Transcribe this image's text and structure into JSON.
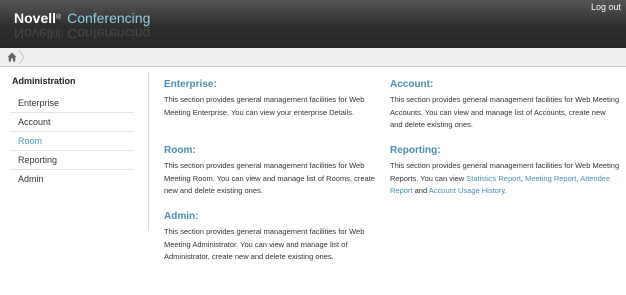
{
  "header": {
    "brand_name": "Novell",
    "brand_mark": "®",
    "product": "Conferencing",
    "logout_label": "Log out"
  },
  "breadcrumb": {
    "home_icon": "home-icon"
  },
  "sidebar": {
    "title": "Administration",
    "items": [
      {
        "label": "Enterprise"
      },
      {
        "label": "Account"
      },
      {
        "label": "Room"
      },
      {
        "label": "Reporting"
      },
      {
        "label": "Admin"
      }
    ],
    "active_item": "Room"
  },
  "sections": {
    "enterprise": {
      "title": "Enterprise:",
      "text": "This section provides general management facilities for Web Meeting Enterprise. You can view your enterprise Details."
    },
    "account": {
      "title": "Account:",
      "text": "This section provides general management facilities for Web Meeting Accounts. You can view and manage list of Accounts, create new and delete existing ones."
    },
    "room": {
      "title": "Room:",
      "text": "This section provides general management facilities for Web Meeting Room. You can view and manage list of Rooms, create new and delete existing ones."
    },
    "reporting": {
      "title": "Reporting:",
      "text_prefix": "This section provides general management facilities for Web Meeting Reports. You can view ",
      "links": [
        "Statistics Report",
        "Meeting Report",
        "Attendee Report",
        "Account Usage History"
      ],
      "sep1": ", ",
      "sep2": ", ",
      "sep3": " and ",
      "text_suffix": "."
    },
    "admin": {
      "title": "Admin:",
      "text": "This section provides general management facilities for Web Meeting Administrator. You can view and manage list of Administrator, create new and delete existing ones."
    }
  },
  "colors": {
    "accent": "#4a8fb0",
    "header_dark": "#2e2e2e",
    "brand_product": "#8fd0e6"
  }
}
